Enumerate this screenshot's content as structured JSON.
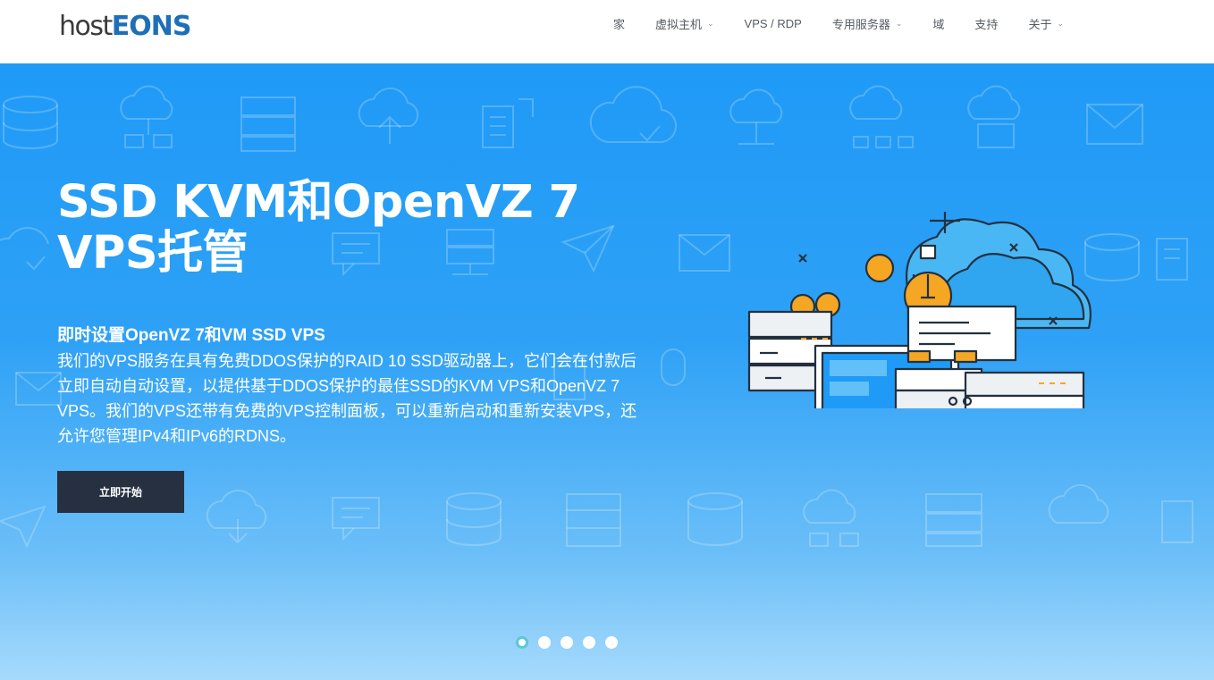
{
  "header": {
    "logo": {
      "part1": "host",
      "part2": "EONS"
    },
    "nav": [
      {
        "label": "家",
        "dropdown": false
      },
      {
        "label": "虚拟主机",
        "dropdown": true
      },
      {
        "label": "VPS / RDP",
        "dropdown": false
      },
      {
        "label": "专用服务器",
        "dropdown": true
      },
      {
        "label": "域",
        "dropdown": false
      },
      {
        "label": "支持",
        "dropdown": false
      },
      {
        "label": "关于",
        "dropdown": true
      }
    ]
  },
  "hero": {
    "title_line1": "SSD KVM和OpenVZ 7",
    "title_line2": "VPS托管",
    "subtitle": "即时设置OpenVZ 7和VM SSD VPS",
    "description": "我们的VPS服务在具有免费DDOS保护的RAID 10 SSD驱动器上，它们会在付款后立即自动自动设置，以提供基于DDOS保护的最佳SSD的KVM VPS和OpenVZ 7 VPS。我们的VPS还带有免费的VPS控制面板，可以重新启动和重新安装VPS，还允许您管理IPv4和IPv6的RDNS。",
    "cta_label": "立即开始"
  },
  "slider": {
    "slides": 5,
    "active": 1
  },
  "colors": {
    "hero_top": "#1f9af7",
    "hero_bottom": "#a6dafc",
    "cta_bg": "#273041",
    "logo_accent": "#1e6fb8",
    "active_dot": "#5ec9cf",
    "illustration_accent": "#f5a623"
  }
}
